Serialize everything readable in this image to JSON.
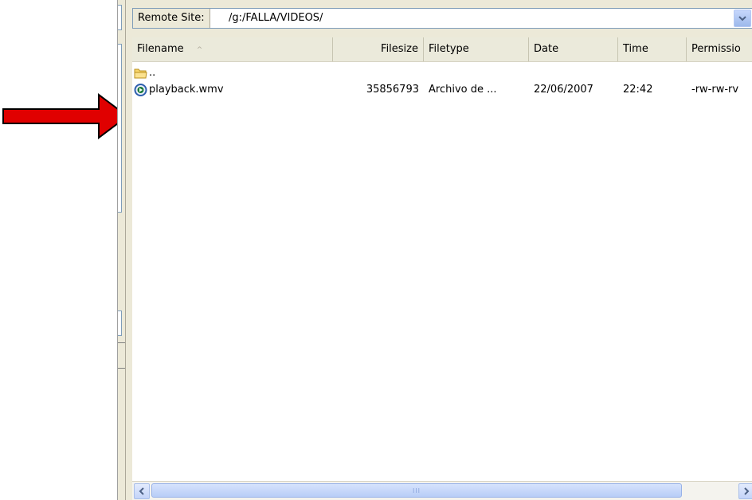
{
  "remote_site": {
    "label": "Remote Site:",
    "path": "/g:/FALLA/VIDEOS/"
  },
  "columns": [
    "Filename",
    "Filesize",
    "Filetype",
    "Date",
    "Time",
    "Permissio"
  ],
  "sort_indicator": "^",
  "files": [
    {
      "name": "..",
      "size": "",
      "type": "",
      "date": "",
      "time": "",
      "perms": "",
      "icon": "folder-icon"
    },
    {
      "name": "playback.wmv",
      "size": "35856793",
      "type": "Archivo de ...",
      "date": "22/06/2007",
      "time": "22:42",
      "perms": "-rw-rw-rv",
      "icon": "media-file-icon"
    }
  ],
  "scrollbar": {
    "grip": "III"
  },
  "colors": {
    "annotation_arrow": "#e00000",
    "panel": "#ece9d8"
  }
}
